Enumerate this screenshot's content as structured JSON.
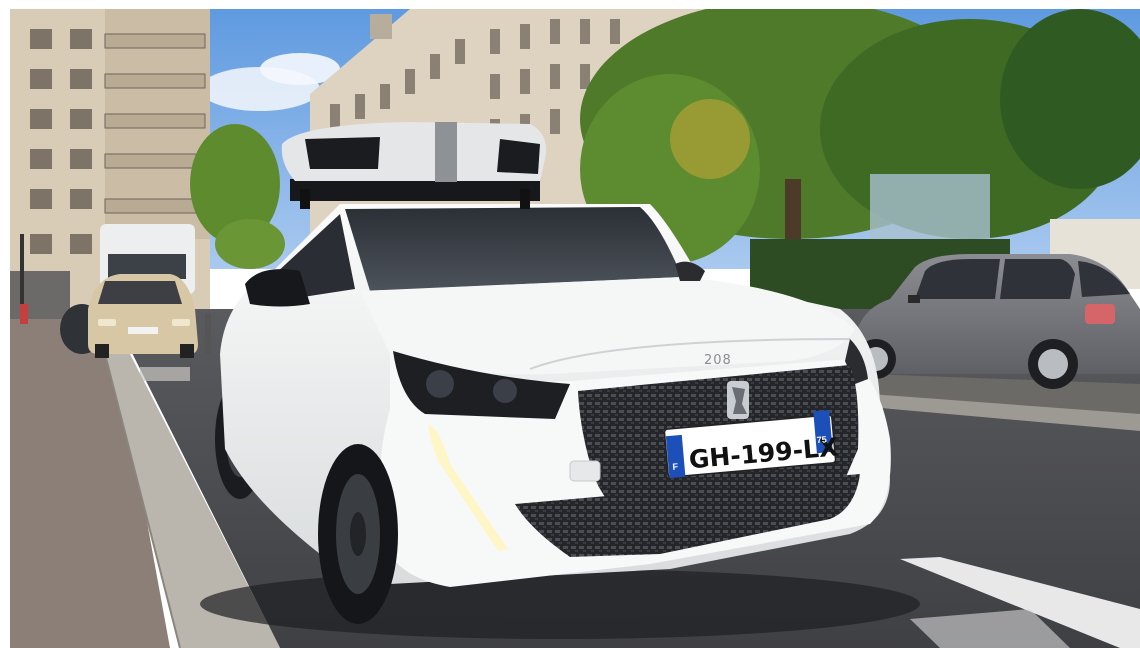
{
  "photo": {
    "main_plate": {
      "text": "GH-199-LX",
      "region_code": "75",
      "country_code": "F"
    },
    "model_badge": "208",
    "colors": {
      "sky": "#6ea6e6",
      "building": "#d9cbb2",
      "car_body": "#f4f5f5",
      "grille": "#2a2c30",
      "road": "#4a4b4f",
      "sidewalk": "#8c7f78",
      "curb": "#bcb8b0",
      "foliage": "#4f7a2a",
      "grey_car": "#7d7e84",
      "beige_car": "#d8c7a4",
      "plate_blue": "#1d4fb8"
    }
  }
}
